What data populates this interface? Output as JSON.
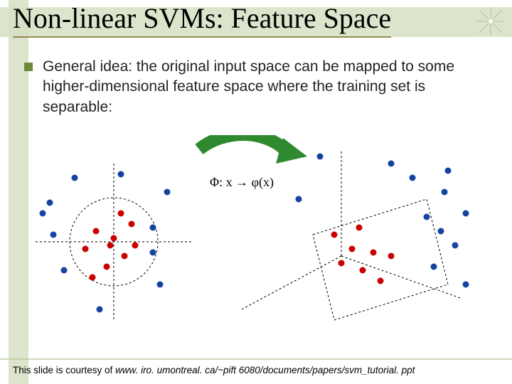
{
  "title": "Non-linear SVMs:  Feature Space",
  "bullet": "General idea:  the original input space can be mapped to some higher-dimensional feature space where the training set is separable:",
  "map_label": "Φ:  x → φ(x)",
  "footer_prefix": "This slide is courtesy of ",
  "footer_url": "www. iro. umontreal. ca/~pift 6080/documents/papers/svm_tutorial. ppt",
  "chart_data": {
    "type": "scatter",
    "panels": [
      {
        "name": "input-space-2d",
        "axes": "2d-cross",
        "boundary": "circle",
        "series": [
          {
            "name": "class-red-inside",
            "color": "#cc0000",
            "points": [
              [
                -40,
                -10
              ],
              [
                -25,
                15
              ],
              [
                -10,
                -35
              ],
              [
                0,
                5
              ],
              [
                15,
                -20
              ],
              [
                25,
                25
              ],
              [
                10,
                40
              ],
              [
                -30,
                -50
              ],
              [
                -5,
                -5
              ],
              [
                30,
                -5
              ]
            ]
          },
          {
            "name": "class-blue-outside",
            "color": "#1544a0",
            "points": [
              [
                -100,
                40
              ],
              [
                -90,
                55
              ],
              [
                -85,
                10
              ],
              [
                -70,
                -40
              ],
              [
                -20,
                -95
              ],
              [
                55,
                -15
              ],
              [
                55,
                20
              ],
              [
                65,
                -60
              ],
              [
                75,
                70
              ],
              [
                -55,
                90
              ],
              [
                10,
                95
              ]
            ]
          }
        ]
      },
      {
        "name": "feature-space-3d",
        "axes": "3d-isometric",
        "boundary": "tilted-plane",
        "series": [
          {
            "name": "class-red-below",
            "color": "#cc0000",
            "points": [
              [
                0,
                -10
              ],
              [
                15,
                10
              ],
              [
                30,
                -20
              ],
              [
                45,
                5
              ],
              [
                55,
                -35
              ],
              [
                70,
                0
              ],
              [
                25,
                40
              ],
              [
                -10,
                30
              ]
            ]
          },
          {
            "name": "class-blue-above",
            "color": "#1544a0",
            "points": [
              [
                120,
                55
              ],
              [
                140,
                35
              ],
              [
                145,
                90
              ],
              [
                160,
                15
              ],
              [
                175,
                60
              ],
              [
                150,
                120
              ],
              [
                100,
                110
              ],
              [
                70,
                130
              ],
              [
                -60,
                80
              ],
              [
                -30,
                140
              ],
              [
                175,
                -40
              ],
              [
                130,
                -15
              ]
            ]
          }
        ]
      }
    ]
  }
}
